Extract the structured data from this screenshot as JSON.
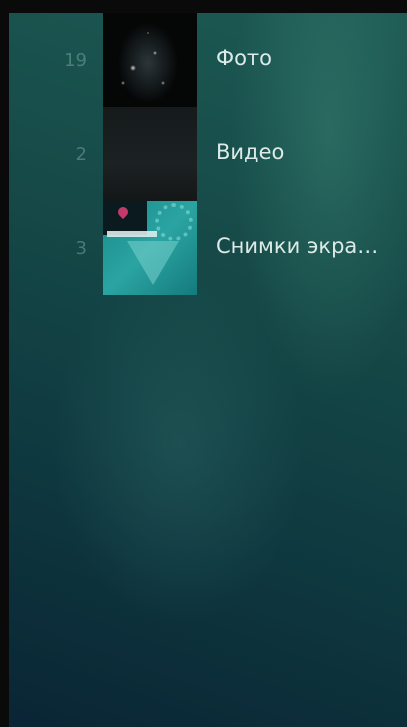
{
  "albums": [
    {
      "count": "19",
      "title": "Фото",
      "thumbnail": "photo-thumbnail"
    },
    {
      "count": "2",
      "title": "Видео",
      "thumbnail": "video-thumbnail"
    },
    {
      "count": "3",
      "title": "Снимки экра…",
      "thumbnail": "screenshots-thumbnail"
    }
  ],
  "colors": {
    "background_top": "#1d5a54",
    "background_bottom": "#0a2535",
    "title_text": "#dcebe8",
    "count_text": "#8cb4af"
  }
}
